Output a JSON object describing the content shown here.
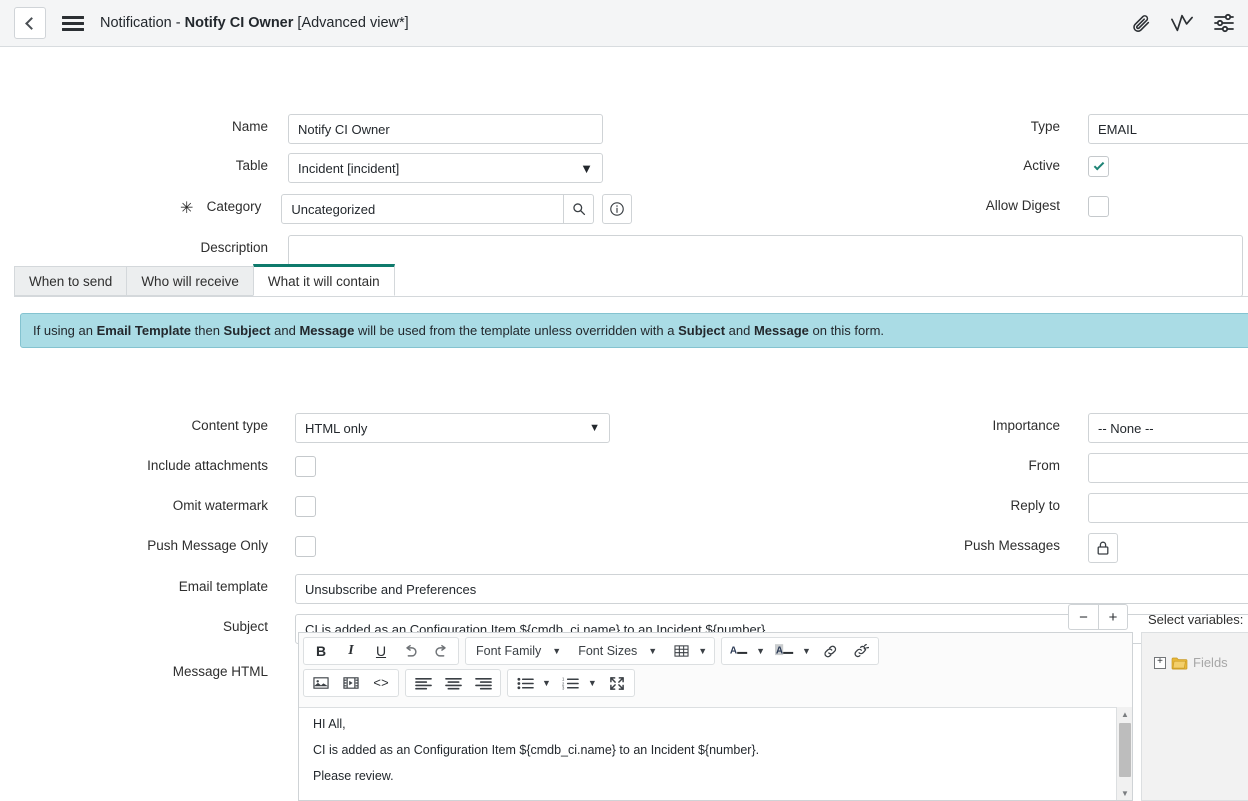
{
  "header": {
    "back_icon": "chevron-left-icon",
    "menu_icon": "hamburger-menu-icon",
    "title_prefix": "Notification - ",
    "title_record": "Notify CI Owner",
    "title_view": " [Advanced view*]",
    "icons": [
      "paperclip-icon",
      "activity-pulse-icon",
      "sliders-personalize-icon"
    ]
  },
  "form": {
    "name": {
      "label": "Name",
      "value": "Notify CI Owner"
    },
    "table": {
      "label": "Table",
      "value": "Incident [incident]"
    },
    "category": {
      "label": "Category",
      "value": "Uncategorized",
      "required_marker": "✳",
      "lookup_icon": "search-icon",
      "info_icon": "info-circle-icon"
    },
    "description": {
      "label": "Description",
      "value": ""
    },
    "type": {
      "label": "Type",
      "value": "EMAIL"
    },
    "active": {
      "label": "Active",
      "checked": true
    },
    "allow_digest": {
      "label": "Allow Digest",
      "checked": false
    }
  },
  "tabs": [
    {
      "label": "When to send",
      "active": false
    },
    {
      "label": "Who will receive",
      "active": false
    },
    {
      "label": "What it will contain",
      "active": true
    }
  ],
  "banner": {
    "seg1": "If using an ",
    "b1": "Email Template",
    "seg2": " then ",
    "b2": "Subject",
    "seg3": " and ",
    "b3": "Message",
    "seg4": " will be used from the template unless overridden with a ",
    "b4": "Subject",
    "seg5": " and ",
    "b5": "Message",
    "seg6": " on this form."
  },
  "content": {
    "content_type": {
      "label": "Content type",
      "value": "HTML only"
    },
    "include_attachments": {
      "label": "Include attachments",
      "checked": false
    },
    "omit_watermark": {
      "label": "Omit watermark",
      "checked": false
    },
    "push_message_only": {
      "label": "Push Message Only",
      "checked": false
    },
    "importance": {
      "label": "Importance",
      "value": "-- None --"
    },
    "from": {
      "label": "From",
      "value": ""
    },
    "reply_to": {
      "label": "Reply to",
      "value": ""
    },
    "push_messages": {
      "label": "Push Messages",
      "icon": "lock-icon"
    },
    "email_template": {
      "label": "Email template",
      "value": "Unsubscribe and Preferences"
    },
    "subject": {
      "label": "Subject",
      "value": "CI is added as an Configuration Item ${cmdb_ci.name} to an Incident ${number}"
    },
    "message_html": {
      "label": "Message HTML"
    }
  },
  "editor": {
    "zoom_out": "−",
    "zoom_in": "+",
    "toolbar_row1": {
      "bold": "B",
      "italic": "I",
      "underline": "U",
      "undo_icon": "undo-arrow-icon",
      "redo_icon": "redo-arrow-icon",
      "font_family": "Font Family",
      "font_sizes": "Font Sizes",
      "table_icon": "table-icon",
      "text_color_icon": "text-color-icon",
      "background_color_icon": "background-color-icon",
      "link_icon": "link-icon",
      "unlink_icon": "unlink-icon"
    },
    "toolbar_row2": {
      "image_icon": "insert-image-icon",
      "media_icon": "insert-media-icon",
      "source_code_icon": "source-code-icon",
      "align_left_icon": "align-left-icon",
      "align_center_icon": "align-center-icon",
      "align_right_icon": "align-right-icon",
      "bullet_list_icon": "bullet-list-icon",
      "numbered_list_icon": "numbered-list-icon",
      "fullscreen_icon": "fullscreen-icon"
    },
    "body": [
      "HI All,",
      "CI is added as an Configuration Item ${cmdb_ci.name} to an Incident ${number}.",
      "Please review."
    ]
  },
  "variables": {
    "label": "Select variables:",
    "expander": "+",
    "folder_icon": "folder-icon",
    "node_label": "Fields"
  },
  "colors": {
    "accent_teal": "#0f7a6c",
    "banner_bg": "#aadce5",
    "header_bg": "#f4f5f6",
    "folder_yellow": "#e8b73a"
  }
}
